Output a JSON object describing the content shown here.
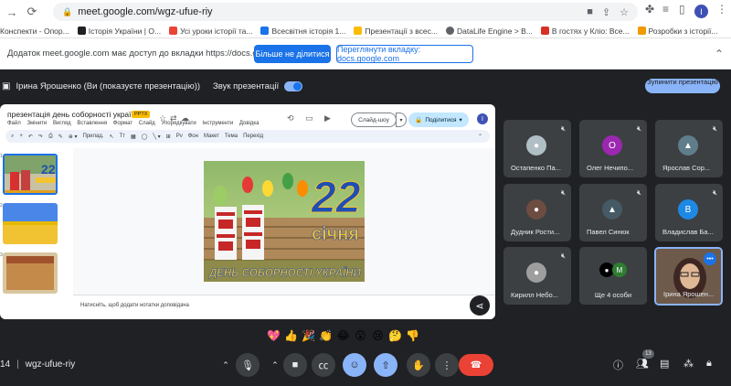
{
  "browser": {
    "url": "meet.google.com/wgz-ufue-riy",
    "profile_initial": "I",
    "bookmarks": [
      {
        "label": "Конспекти - Опор...",
        "color": "#4285f4"
      },
      {
        "label": "Історія України | О...",
        "color": "#202124"
      },
      {
        "label": "Усі уроки історії та...",
        "color": "#ea4335"
      },
      {
        "label": "Всесвітня історія 1...",
        "color": "#1a73e8"
      },
      {
        "label": "Презентації з всес...",
        "color": "#fbbc04"
      },
      {
        "label": "DataLife Engine > В...",
        "color": "#5f6368"
      },
      {
        "label": "В гостях у Кліо: Все...",
        "color": "#d93025"
      },
      {
        "label": "Розробки з історії...",
        "color": "#f29900"
      }
    ]
  },
  "share_bar": {
    "message": "Додаток meet.google.com має доступ до вкладки https://docs.google.com",
    "stop_sharing_label": "Більше не ділитися",
    "switch_tab_label": "Переглянути вкладку: docs.google.com"
  },
  "meet": {
    "presenter_label": "Ірина Ярошенко (Ви (показуєте презентацію))",
    "sound_label": "Звук презентації",
    "stop_presenting_label": "Зупинити презентацію",
    "meeting_time": "14",
    "meeting_code": "wgz-ufue-riy",
    "people_count": "13"
  },
  "slides": {
    "title": "презентація день соборності україни",
    "badge": "PPTX",
    "menu": [
      "Файл",
      "Змінити",
      "Вигляд",
      "Вставлення",
      "Формат",
      "Слайд",
      "Упорядкувати",
      "Інструменти",
      "Довідка"
    ],
    "slideshow_label": "Слайд-шоу",
    "share_label": "Поділитися",
    "avatar_initial": "I",
    "toolbar_items": [
      "Прилад.",
      "Фон",
      "Макет",
      "Тема",
      "Перехід"
    ],
    "notes_placeholder": "Натисніть, щоб додати нотатки доповідача",
    "slide_number_text": "22",
    "slide_word": "січня",
    "slide_caption": "ДЕНЬ СОБОРНОСТІ УКРАЇНИ",
    "thumb_numbers": [
      "1",
      "2",
      "3"
    ]
  },
  "participants": [
    {
      "name": "Остапенко Па...",
      "avatar_color": "#b0bec5",
      "initial": ""
    },
    {
      "name": "Олег Нечипо...",
      "avatar_color": "#9c27b0",
      "initial": "O"
    },
    {
      "name": "Ярослав Сор...",
      "avatar_color": "#607d8b",
      "initial": ""
    },
    {
      "name": "Дудник Рости...",
      "avatar_color": "#6d4c41",
      "initial": ""
    },
    {
      "name": "Павел Синюк",
      "avatar_color": "#455a64",
      "initial": ""
    },
    {
      "name": "Владислав Ба...",
      "avatar_color": "#1e88e5",
      "initial": "B"
    },
    {
      "name": "Кирилл Небо...",
      "avatar_color": "#9e9e9e",
      "initial": ""
    },
    {
      "name": "Ще 4 особи",
      "avatar_color": "#000000",
      "initial": "M"
    },
    {
      "name": "Ірина Ярошен...",
      "avatar_color": "#ffcc80",
      "initial": ""
    }
  ],
  "reactions": [
    "💖",
    "👍",
    "🎉",
    "👏",
    "😂",
    "😮",
    "😢",
    "🤔",
    "👎"
  ],
  "colors": {
    "meet_bg": "#202124",
    "accent_blue": "#1a73e8",
    "light_blue": "#8ab4f8",
    "leave_red": "#ea4335"
  }
}
